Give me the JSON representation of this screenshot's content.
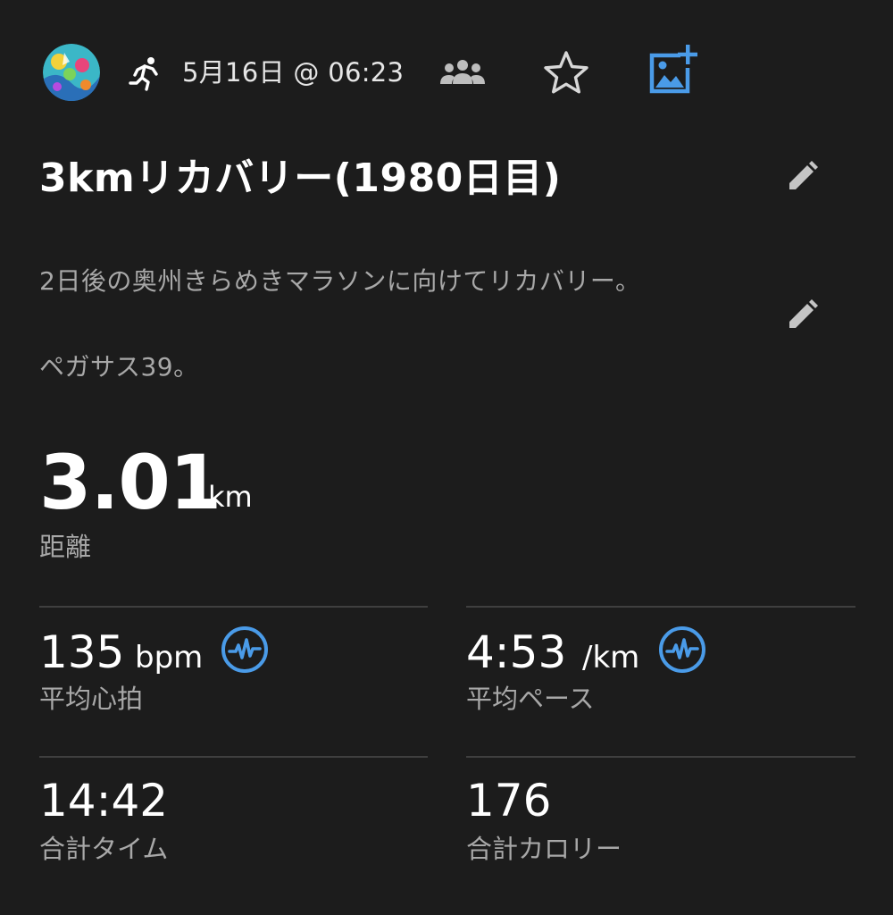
{
  "header": {
    "date": "5月16日 @ 06:23",
    "icons": {
      "activity": "running-person-icon",
      "group": "group-icon",
      "favorite": "star-icon",
      "add_photo": "add-photo-icon"
    },
    "accent_color": "#4a9be8"
  },
  "activity": {
    "title": "3kmリカバリー(1980日目)",
    "description_lines": [
      "2日後の奥州きらめきマラソンに向けてリカバリー。",
      "ペガサス39。"
    ]
  },
  "distance": {
    "value": "3.01",
    "unit": "km",
    "label": "距離"
  },
  "metrics": {
    "avg_hr": {
      "value": "135",
      "unit": "bpm",
      "label": "平均心拍"
    },
    "avg_pace": {
      "value": "4:53",
      "unit": "/km",
      "label": "平均ペース"
    },
    "total_time": {
      "value": "14:42",
      "label": "合計タイム"
    },
    "total_calories": {
      "value": "176",
      "label": "合計カロリー"
    }
  }
}
